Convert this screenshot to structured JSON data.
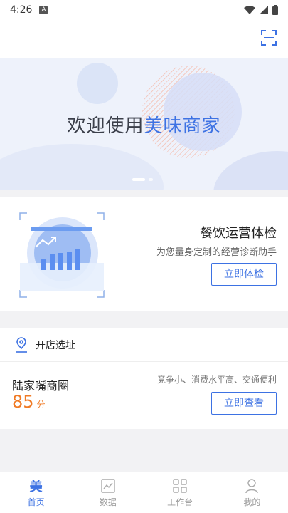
{
  "status_bar": {
    "time": "4:26",
    "notification_badge": "A"
  },
  "banner": {
    "title_prefix": "欢迎使用",
    "title_brand": "美味商家",
    "accent_color": "#3d72e3"
  },
  "health_check": {
    "title": "餐饮运营体检",
    "subtitle": "为您量身定制的经营诊断助手",
    "button_label": "立即体检"
  },
  "site_selection": {
    "header_label": "开店选址",
    "area_name": "陆家嘴商圈",
    "score": "85",
    "score_unit": "分",
    "tags": "竞争小、消费水平高、交通便利",
    "button_label": "立即查看",
    "score_color": "#f07a24"
  },
  "tabbar": {
    "items": [
      {
        "label": "首页",
        "icon": "home-mei-icon",
        "glyph": "美",
        "active": true
      },
      {
        "label": "数据",
        "icon": "chart-icon",
        "active": false
      },
      {
        "label": "工作台",
        "icon": "grid-icon",
        "active": false
      },
      {
        "label": "我的",
        "icon": "person-icon",
        "active": false
      }
    ]
  }
}
